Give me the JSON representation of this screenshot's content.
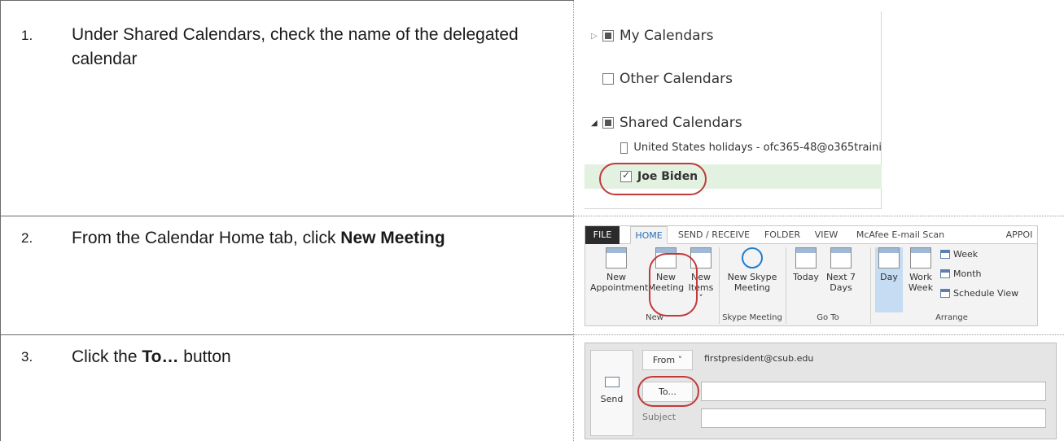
{
  "steps": [
    {
      "number": "1.",
      "text": "Under Shared Calendars, check the name of the delegated calendar"
    },
    {
      "number": "2.",
      "text_prefix": "From the Calendar Home tab, click ",
      "text_bold": "New Meeting"
    },
    {
      "number": "3.",
      "text_prefix": "Click the ",
      "text_bold": "To…",
      "text_suffix": " button"
    }
  ],
  "calendar_pane": {
    "my_calendars": "My Calendars",
    "other_calendars": "Other Calendars",
    "shared_calendars": "Shared Calendars",
    "items": [
      {
        "label": "United States holidays - ofc365-48@o365traini",
        "checked": false
      },
      {
        "label": "Joe Biden",
        "checked": true
      }
    ],
    "highlight_color": "#e3f1e0",
    "circle_color": "#c0393b"
  },
  "ribbon": {
    "tabs": [
      "FILE",
      "HOME",
      "SEND / RECEIVE",
      "FOLDER",
      "VIEW",
      "McAfee E-mail Scan",
      "APPOI"
    ],
    "active_tab": "HOME",
    "buttons": {
      "new_appointment": [
        "New",
        "Appointment"
      ],
      "new_meeting": [
        "New",
        "Meeting"
      ],
      "new_items": [
        "New",
        "Items ˅"
      ],
      "new_skype_meeting": [
        "New Skype",
        "Meeting"
      ],
      "today": [
        "Today"
      ],
      "next_7_days": [
        "Next 7",
        "Days"
      ],
      "day": [
        "Day"
      ],
      "work_week": [
        "Work",
        "Week"
      ],
      "week": "Week",
      "month": "Month",
      "schedule_view": "Schedule View"
    },
    "groups": [
      "New",
      "Skype Meeting",
      "Go To",
      "Arrange"
    ]
  },
  "compose": {
    "send_label": "Send",
    "from_label": "From ˅",
    "from_address": "firstpresident@csub.edu",
    "to_label": "To...",
    "subject_label": "Subject",
    "to_value": "",
    "subject_value": ""
  }
}
